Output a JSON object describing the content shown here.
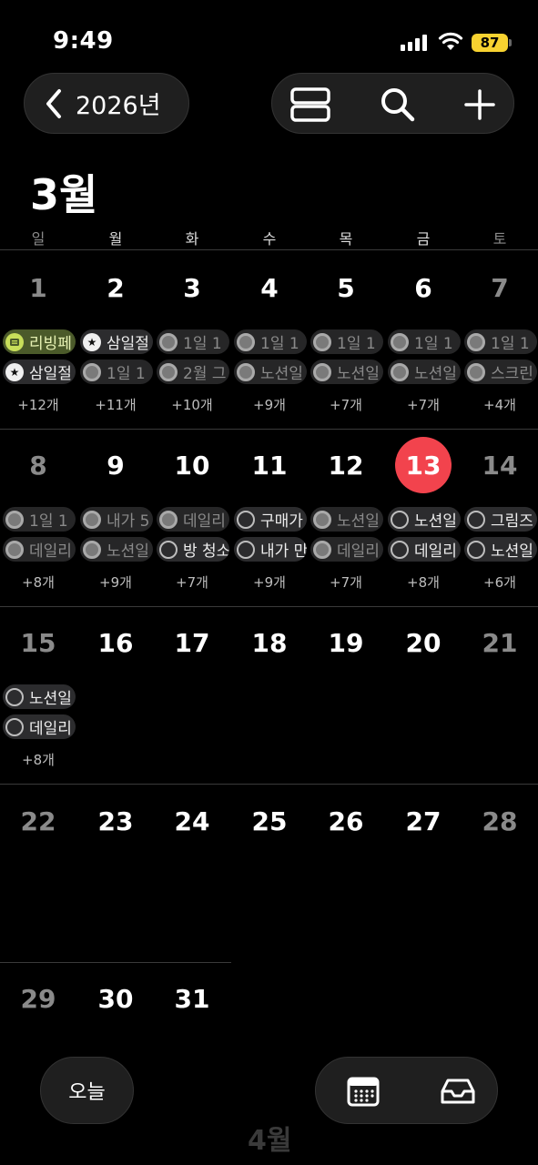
{
  "status": {
    "time": "9:49",
    "battery": "87"
  },
  "header": {
    "year_label": "2026년"
  },
  "icons": {
    "back": "chevron-left-icon",
    "view": "list-view-icon",
    "search": "search-icon",
    "add": "plus-icon",
    "calendar": "calendar-icon",
    "inbox": "inbox-icon"
  },
  "month": {
    "title": "3월"
  },
  "weekdays": [
    "일",
    "월",
    "화",
    "수",
    "목",
    "금",
    "토"
  ],
  "weeks": [
    {
      "days": [
        "1",
        "2",
        "3",
        "4",
        "5",
        "6",
        "7"
      ],
      "events": [
        [
          {
            "text": "리빙페",
            "style": "green"
          },
          {
            "text": "삼일절",
            "style": "star"
          }
        ],
        [
          {
            "text": "삼일절",
            "style": "star"
          },
          {
            "text": "1일 1",
            "style": "muted"
          }
        ],
        [
          {
            "text": "1일 1",
            "style": "muted"
          },
          {
            "text": "2월 그",
            "style": "muted"
          }
        ],
        [
          {
            "text": "1일 1",
            "style": "muted"
          },
          {
            "text": "노션일",
            "style": "muted"
          }
        ],
        [
          {
            "text": "1일 1",
            "style": "muted"
          },
          {
            "text": "노션일",
            "style": "muted"
          }
        ],
        [
          {
            "text": "1일 1",
            "style": "muted"
          },
          {
            "text": "노션일",
            "style": "muted"
          }
        ],
        [
          {
            "text": "1일 1",
            "style": "muted"
          },
          {
            "text": "스크린",
            "style": "muted"
          }
        ]
      ],
      "more": [
        "+12개",
        "+11개",
        "+10개",
        "+9개",
        "+7개",
        "+7개",
        "+4개"
      ]
    },
    {
      "days": [
        "8",
        "9",
        "10",
        "11",
        "12",
        "13",
        "14"
      ],
      "events": [
        [
          {
            "text": "1일 1",
            "style": "muted"
          },
          {
            "text": "데일리",
            "style": "muted"
          }
        ],
        [
          {
            "text": "내가 5",
            "style": "muted"
          },
          {
            "text": "노션일",
            "style": "muted"
          }
        ],
        [
          {
            "text": "데일리",
            "style": "muted"
          },
          {
            "text": "방 청소",
            "style": "ring"
          }
        ],
        [
          {
            "text": "구매가",
            "style": "ring"
          },
          {
            "text": "내가 만",
            "style": "ring"
          }
        ],
        [
          {
            "text": "노션일",
            "style": "muted"
          },
          {
            "text": "데일리",
            "style": "muted"
          }
        ],
        [
          {
            "text": "노션일",
            "style": "ring"
          },
          {
            "text": "데일리",
            "style": "ring"
          }
        ],
        [
          {
            "text": "그림즈",
            "style": "ring"
          },
          {
            "text": "노션일",
            "style": "ring"
          }
        ]
      ],
      "more": [
        "+8개",
        "+9개",
        "+7개",
        "+9개",
        "+7개",
        "+8개",
        "+6개"
      ]
    },
    {
      "days": [
        "15",
        "16",
        "17",
        "18",
        "19",
        "20",
        "21"
      ],
      "events": [
        [
          {
            "text": "노션일",
            "style": "ring"
          },
          {
            "text": "데일리",
            "style": "ring"
          }
        ],
        [],
        [],
        [],
        [],
        [],
        []
      ],
      "more": [
        "+8개",
        "",
        "",
        "",
        "",
        "",
        ""
      ]
    },
    {
      "days": [
        "22",
        "23",
        "24",
        "25",
        "26",
        "27",
        "28"
      ],
      "events": [
        [],
        [],
        [],
        [],
        [],
        [],
        []
      ],
      "more": [
        "",
        "",
        "",
        "",
        "",
        "",
        ""
      ]
    },
    {
      "days": [
        "29",
        "30",
        "31",
        "",
        "",
        "",
        ""
      ],
      "events": [
        [],
        [],
        [],
        [],
        [],
        [],
        []
      ],
      "more": [
        "",
        "",
        "",
        "",
        "",
        "",
        ""
      ]
    }
  ],
  "today_index": {
    "week": 1,
    "day": 5
  },
  "footer": {
    "today_label": "오늘",
    "next_month_label": "4월"
  },
  "colors": {
    "today": "#f2434d",
    "battery": "#f7d230",
    "background": "#000000"
  }
}
